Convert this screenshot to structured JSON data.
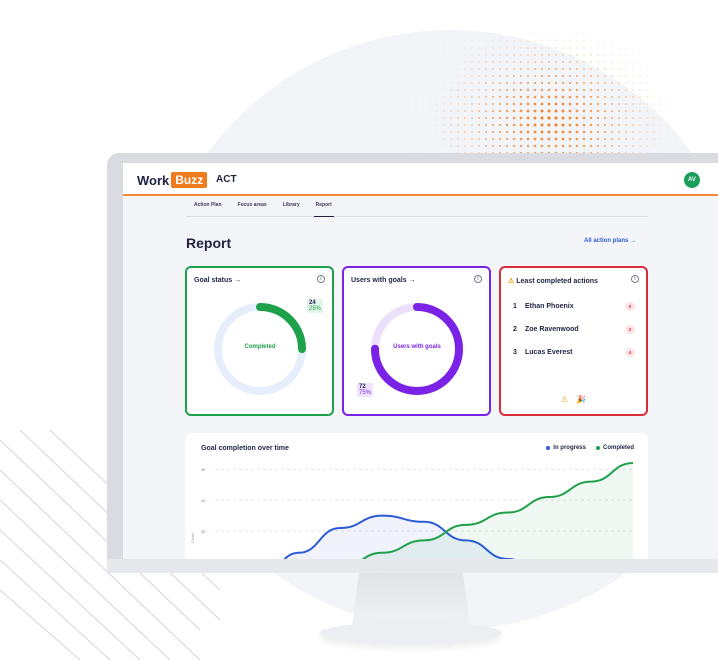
{
  "app": {
    "logo_work": "Work",
    "logo_buzz": "Buzz",
    "name": "ACT",
    "avatar": "AV"
  },
  "nav": {
    "tabs": [
      "Action Plan",
      "Focus areas",
      "Library",
      "Report"
    ],
    "active": "Report"
  },
  "page": {
    "title": "Report",
    "all_plans_link": "All action plans →"
  },
  "goal_status": {
    "title": "Goal status →",
    "center": "Completed",
    "count": "24",
    "percent": "25%",
    "fraction": 0.25,
    "color": "#1fa14b"
  },
  "users_with_goals": {
    "title": "Users with goals →",
    "center": "Users with goals",
    "count": "72",
    "percent": "75%",
    "fraction": 0.75,
    "color": "#7a22e6"
  },
  "least_completed": {
    "title": "Least completed actions",
    "warning_icon": "⚠",
    "items": [
      {
        "rank": "1",
        "name": "Ethan Phoenix",
        "count": "0"
      },
      {
        "rank": "2",
        "name": "Zoe Ravenwood",
        "count": "2"
      },
      {
        "rank": "3",
        "name": "Lucas Everest",
        "count": "4"
      }
    ],
    "footer_icons": [
      "⚠",
      "🎉"
    ]
  },
  "colors": {
    "orange": "#f07a1e",
    "green": "#1fa14b",
    "purple": "#7a22e6",
    "red": "#d62f3a",
    "blue": "#2b5bd7"
  },
  "chart_data": {
    "type": "line",
    "title": "Goal completion over time",
    "ylabel": "Goals",
    "yticks": [
      "50",
      "40",
      "30",
      "20"
    ],
    "ylim": [
      10,
      52
    ],
    "x": [
      0,
      1,
      2,
      3,
      4,
      5,
      6,
      7,
      8,
      9,
      10
    ],
    "series": [
      {
        "name": "In progress",
        "color": "#2b5bd7",
        "values": [
          5,
          13,
          23,
          31,
          35,
          33,
          27,
          21,
          15,
          9,
          3
        ]
      },
      {
        "name": "Completed",
        "color": "#1fa14b",
        "values": [
          5,
          9,
          14,
          18,
          23,
          27,
          32,
          36,
          41,
          46,
          52
        ]
      }
    ],
    "grid": true
  }
}
